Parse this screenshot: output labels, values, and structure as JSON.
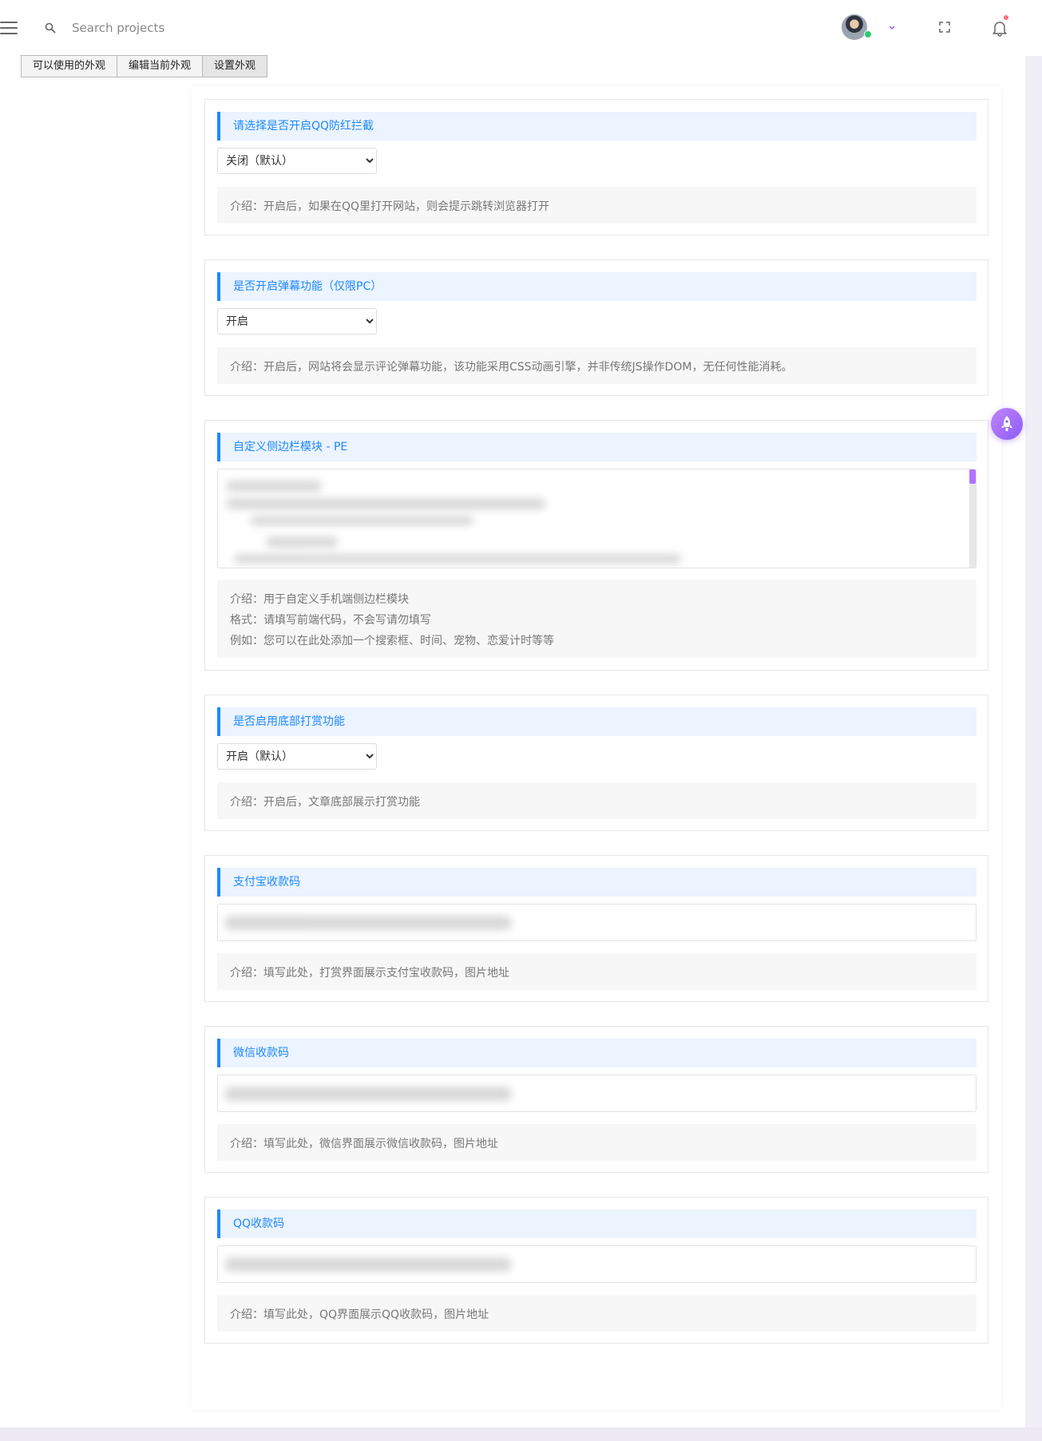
{
  "header": {
    "search_placeholder": "Search projects",
    "icons": [
      "menu-icon",
      "search-icon",
      "avatar",
      "chevron-down-icon",
      "fullscreen-icon",
      "bell-icon"
    ]
  },
  "tabs": [
    {
      "label": "可以使用的外观"
    },
    {
      "label": "编辑当前外观"
    },
    {
      "label": "设置外观"
    }
  ],
  "settings": [
    {
      "title": "请选择是否开启QQ防红拦截",
      "selected": "关闭（默认）",
      "description": "介绍：开启后，如果在QQ里打开网站，则会提示跳转浏览器打开"
    },
    {
      "title": "是否开启弹幕功能（仅限PC）",
      "selected": "开启",
      "description": "介绍：开启后，网站将会显示评论弹幕功能，该功能采用CSS动画引擎，并非传统JS操作DOM，无任何性能消耗。"
    },
    {
      "title": "自定义侧边栏模块 - PE",
      "description_lines": [
        "介绍：用于自定义手机端侧边栏模块",
        "格式：请填写前端代码，不会写请勿填写",
        "例如：您可以在此处添加一个搜索框、时间、宠物、恋爱计时等等"
      ]
    },
    {
      "title": "是否启用底部打赏功能",
      "selected": "开启（默认）",
      "description": "介绍：开启后，文章底部展示打赏功能"
    },
    {
      "title": "支付宝收款码",
      "description": "介绍：填写此处，打赏界面展示支付宝收款码，图片地址"
    },
    {
      "title": "微信收款码",
      "description": "介绍：填写此处，微信界面展示微信收款码，图片地址"
    },
    {
      "title": "QQ收款码",
      "description": "介绍：填写此处，QQ界面展示QQ收款码，图片地址"
    }
  ],
  "colors": {
    "accent": "#1e88ff",
    "title_bg": "#ebf4ff",
    "rocket": "#a46cf7"
  }
}
